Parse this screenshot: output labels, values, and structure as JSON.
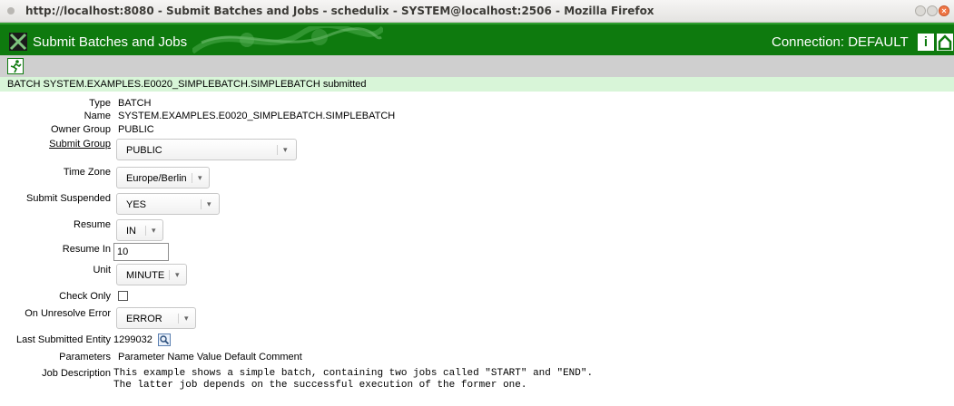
{
  "window": {
    "title": "http://localhost:8080 - Submit Batches and Jobs - schedulix - SYSTEM@localhost:2506 - Mozilla Firefox"
  },
  "header": {
    "app_title": "Submit Batches and Jobs",
    "connection": "Connection: DEFAULT",
    "info_label": "i"
  },
  "message": "BATCH SYSTEM.EXAMPLES.E0020_SIMPLEBATCH.SIMPLEBATCH submitted",
  "form": {
    "type": {
      "label": "Type",
      "value": "BATCH"
    },
    "name": {
      "label": "Name",
      "value": "SYSTEM.EXAMPLES.E0020_SIMPLEBATCH.SIMPLEBATCH"
    },
    "owner_group": {
      "label": "Owner Group",
      "value": "PUBLIC"
    },
    "submit_group": {
      "label": "Submit Group",
      "value": "PUBLIC"
    },
    "time_zone": {
      "label": "Time Zone",
      "value": "Europe/Berlin"
    },
    "submit_suspended": {
      "label": "Submit Suspended",
      "value": "YES"
    },
    "resume": {
      "label": "Resume",
      "value": "IN"
    },
    "resume_in": {
      "label": "Resume In",
      "value": "10"
    },
    "unit": {
      "label": "Unit",
      "value": "MINUTE"
    },
    "check_only": {
      "label": "Check Only",
      "checked": false
    },
    "on_unresolve_error": {
      "label": "On Unresolve Error",
      "value": "ERROR"
    },
    "last_submitted_entity": {
      "label": "Last Submitted Entity",
      "value": "1299032"
    },
    "parameters": {
      "label": "Parameters",
      "columns": [
        "Parameter Name",
        "Value",
        "Default",
        "Comment"
      ]
    },
    "job_description": {
      "label": "Job Description",
      "lines": [
        "This example shows a simple batch, containing two jobs called \"START\" and \"END\".",
        "The latter job depends on the successful execution of the former one."
      ]
    }
  },
  "icons": {
    "close": "close-icon",
    "minimize": "minimize-icon",
    "maximize": "maximize-icon",
    "run": "run-icon",
    "info": "info-icon",
    "home": "home-icon",
    "search": "magnifier-icon"
  }
}
